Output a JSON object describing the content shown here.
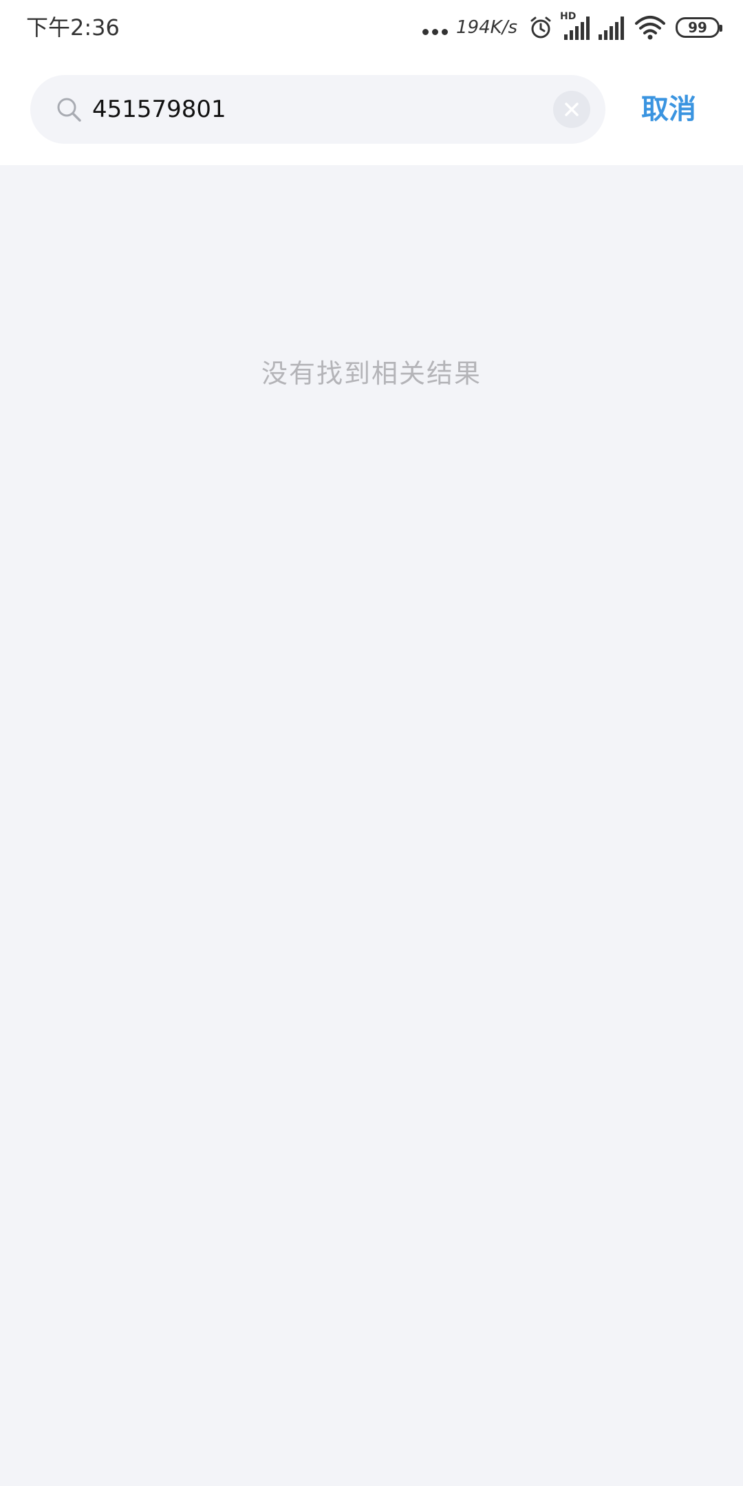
{
  "status_bar": {
    "time": "下午2:36",
    "net_speed": "194K/s",
    "network_label": "HD",
    "battery": "99",
    "icons": [
      "more-dots-icon",
      "alarm-icon",
      "signal-hd-icon",
      "signal-icon",
      "wifi-icon",
      "battery-icon"
    ]
  },
  "search": {
    "value": "451579801",
    "cancel_label": "取消",
    "icons": [
      "search-icon",
      "clear-icon"
    ]
  },
  "results": {
    "empty_message": "没有找到相关结果"
  },
  "colors": {
    "accent": "#3a94e0",
    "background": "#f3f4f8",
    "empty_text": "#b4b4b8"
  }
}
